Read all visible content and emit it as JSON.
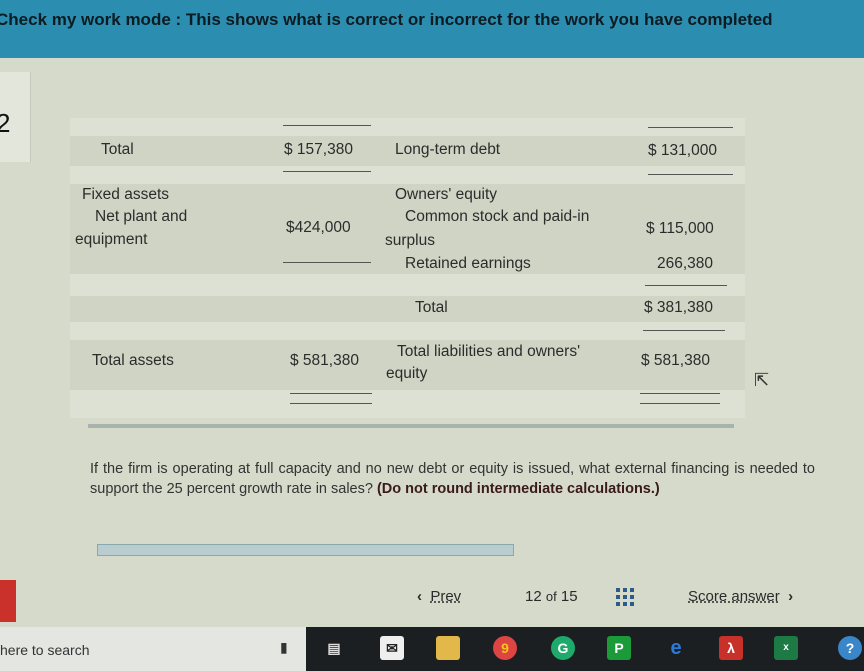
{
  "header": {
    "title": "Check my work mode : This shows what is correct or incorrect for the work you have completed"
  },
  "question_number": "2",
  "balance_sheet": {
    "current_total_label": "Total",
    "current_total_value": "$ 157,380",
    "ltd_label": "Long-term debt",
    "ltd_value": "$ 131,000",
    "fixed_assets_label": "Fixed assets",
    "net_plant_label_1": "Net plant and",
    "net_plant_label_2": "equipment",
    "net_plant_value": "$424,000",
    "owners_equity_label": "Owners' equity",
    "common_stock_label_1": "Common stock and paid-in",
    "common_stock_label_2": "surplus",
    "common_stock_value": "$ 115,000",
    "retained_label": "Retained earnings",
    "retained_value": "266,380",
    "equity_total_label": "Total",
    "equity_total_value": "$ 381,380",
    "total_assets_label": "Total assets",
    "total_assets_value": "$ 581,380",
    "total_le_label_1": "Total liabilities and owners'",
    "total_le_label_2": "equity",
    "total_le_value": "$ 581,380"
  },
  "question": {
    "text": "If the firm is operating at full capacity and no new debt or equity is issued, what external financing is needed to support the 25 percent growth rate in sales?",
    "emphasis": "(Do not round intermediate calculations.)",
    "answer_value": ""
  },
  "nav": {
    "prev": "Prev",
    "page": "12",
    "of": "of",
    "total": "15",
    "score": "Score answer"
  },
  "taskbar": {
    "search_placeholder": "here to search",
    "icons": [
      "task-view",
      "mail",
      "file-explorer",
      "chrome",
      "grammarly",
      "pushbullet",
      "edge",
      "acrobat",
      "excel",
      "help"
    ]
  }
}
